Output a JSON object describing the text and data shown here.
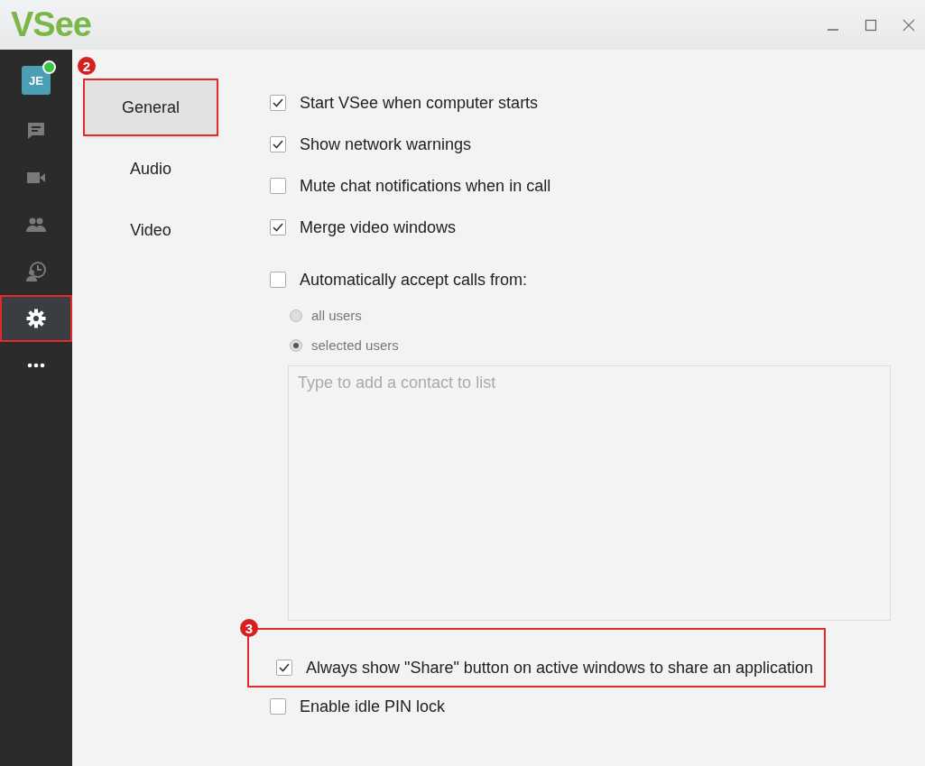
{
  "window": {
    "logo": "VSee"
  },
  "sidebar": {
    "avatar": {
      "initials": "JE",
      "online": true
    },
    "items": [
      {
        "kind": "chat",
        "selected": false,
        "highlighted": false
      },
      {
        "kind": "video",
        "selected": false,
        "highlighted": false
      },
      {
        "kind": "contacts",
        "selected": false,
        "highlighted": false
      },
      {
        "kind": "history",
        "selected": false,
        "highlighted": false
      },
      {
        "kind": "settings",
        "selected": true,
        "highlighted": true
      },
      {
        "kind": "more",
        "selected": false,
        "highlighted": false
      }
    ]
  },
  "tabs": [
    {
      "label": "General",
      "selected": true,
      "highlighted": true,
      "badge": "2"
    },
    {
      "label": "Audio",
      "selected": false,
      "highlighted": false
    },
    {
      "label": "Video",
      "selected": false,
      "highlighted": false
    }
  ],
  "options": [
    {
      "kind": "checkbox",
      "label": "Start VSee when computer starts",
      "checked": true
    },
    {
      "kind": "checkbox",
      "label": "Show network warnings",
      "checked": true
    },
    {
      "kind": "checkbox",
      "label": "Mute chat notifications when in call",
      "checked": false
    },
    {
      "kind": "checkbox",
      "label": "Merge video windows",
      "checked": true
    },
    {
      "kind": "checkbox",
      "label": "Automatically accept calls from:",
      "checked": false,
      "gap": true
    },
    {
      "kind": "radio",
      "label": "all users",
      "selected": false
    },
    {
      "kind": "radio",
      "label": "selected users",
      "selected": true
    },
    {
      "kind": "contact-list",
      "placeholder": "Type to add a contact to list"
    },
    {
      "kind": "checkbox",
      "label": "Always show \"Share\" button on active windows to share an application",
      "checked": true,
      "highlighted": true,
      "badge": "3"
    },
    {
      "kind": "checkbox",
      "label": "Enable idle PIN lock",
      "checked": false
    }
  ]
}
